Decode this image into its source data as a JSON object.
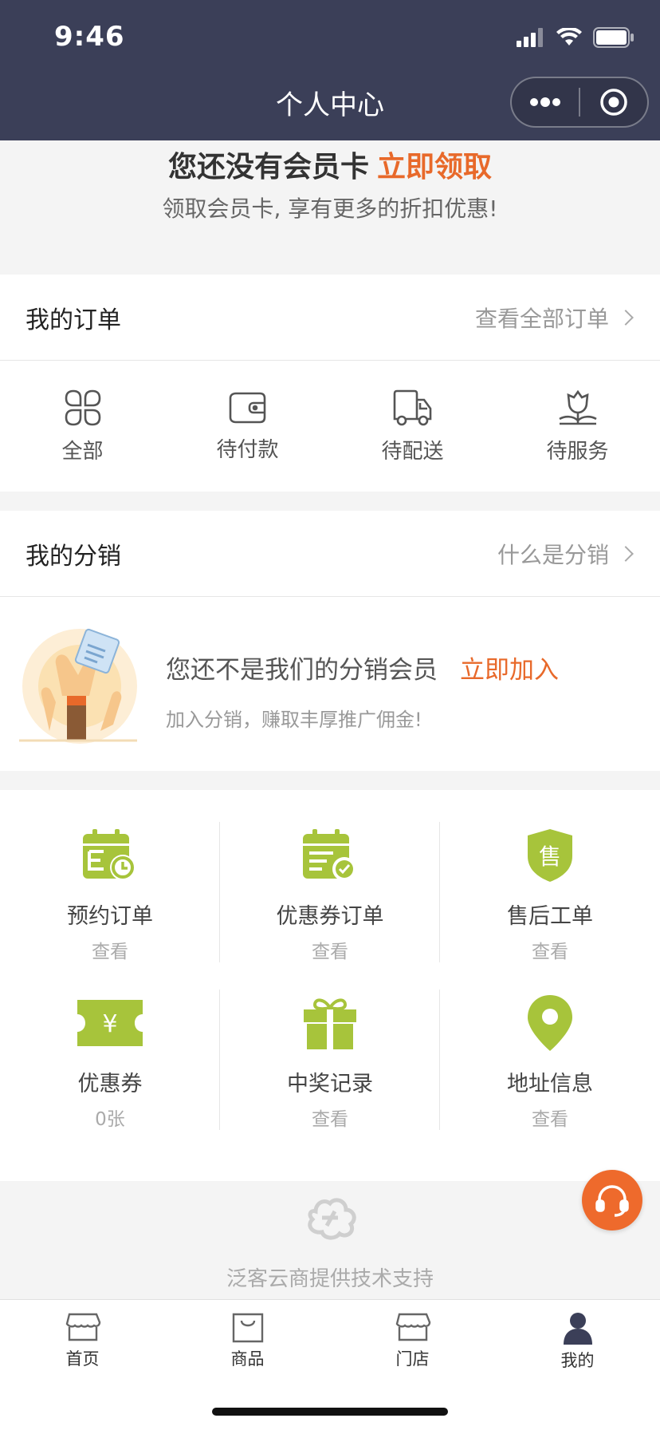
{
  "status": {
    "time": "9:46"
  },
  "nav": {
    "title": "个人中心"
  },
  "member": {
    "line1_prefix": "您还没有会员卡",
    "line1_action": "立即领取",
    "line2": "领取会员卡, 享有更多的折扣优惠!"
  },
  "orders": {
    "title": "我的订单",
    "link": "查看全部订单",
    "items": [
      {
        "label": "全部",
        "icon": "grid-icon"
      },
      {
        "label": "待付款",
        "icon": "wallet-icon"
      },
      {
        "label": "待配送",
        "icon": "truck-icon"
      },
      {
        "label": "待服务",
        "icon": "flower-icon"
      }
    ]
  },
  "distribution": {
    "title": "我的分销",
    "link": "什么是分销",
    "text": "您还不是我们的分销会员",
    "action": "立即加入",
    "sub": "加入分销，赚取丰厚推广佣金!"
  },
  "grid": [
    {
      "title": "预约订单",
      "sub": "查看",
      "icon": "calendar-clock-icon"
    },
    {
      "title": "优惠券订单",
      "sub": "查看",
      "icon": "calendar-check-icon"
    },
    {
      "title": "售后工单",
      "sub": "查看",
      "icon": "shield-icon"
    },
    {
      "title": "优惠券",
      "sub": "0张",
      "icon": "coupon-icon"
    },
    {
      "title": "中奖记录",
      "sub": "查看",
      "icon": "gift-icon"
    },
    {
      "title": "地址信息",
      "sub": "查看",
      "icon": "location-icon"
    }
  ],
  "brand": {
    "text": "泛客云商提供技术支持"
  },
  "tabs": [
    {
      "label": "首页",
      "icon": "shop-icon"
    },
    {
      "label": "商品",
      "icon": "bag-icon"
    },
    {
      "label": "门店",
      "icon": "store-icon"
    },
    {
      "label": "我的",
      "icon": "user-icon"
    }
  ],
  "colors": {
    "header": "#3b3f58",
    "accent": "#e8692a",
    "green": "#a7c43b"
  }
}
